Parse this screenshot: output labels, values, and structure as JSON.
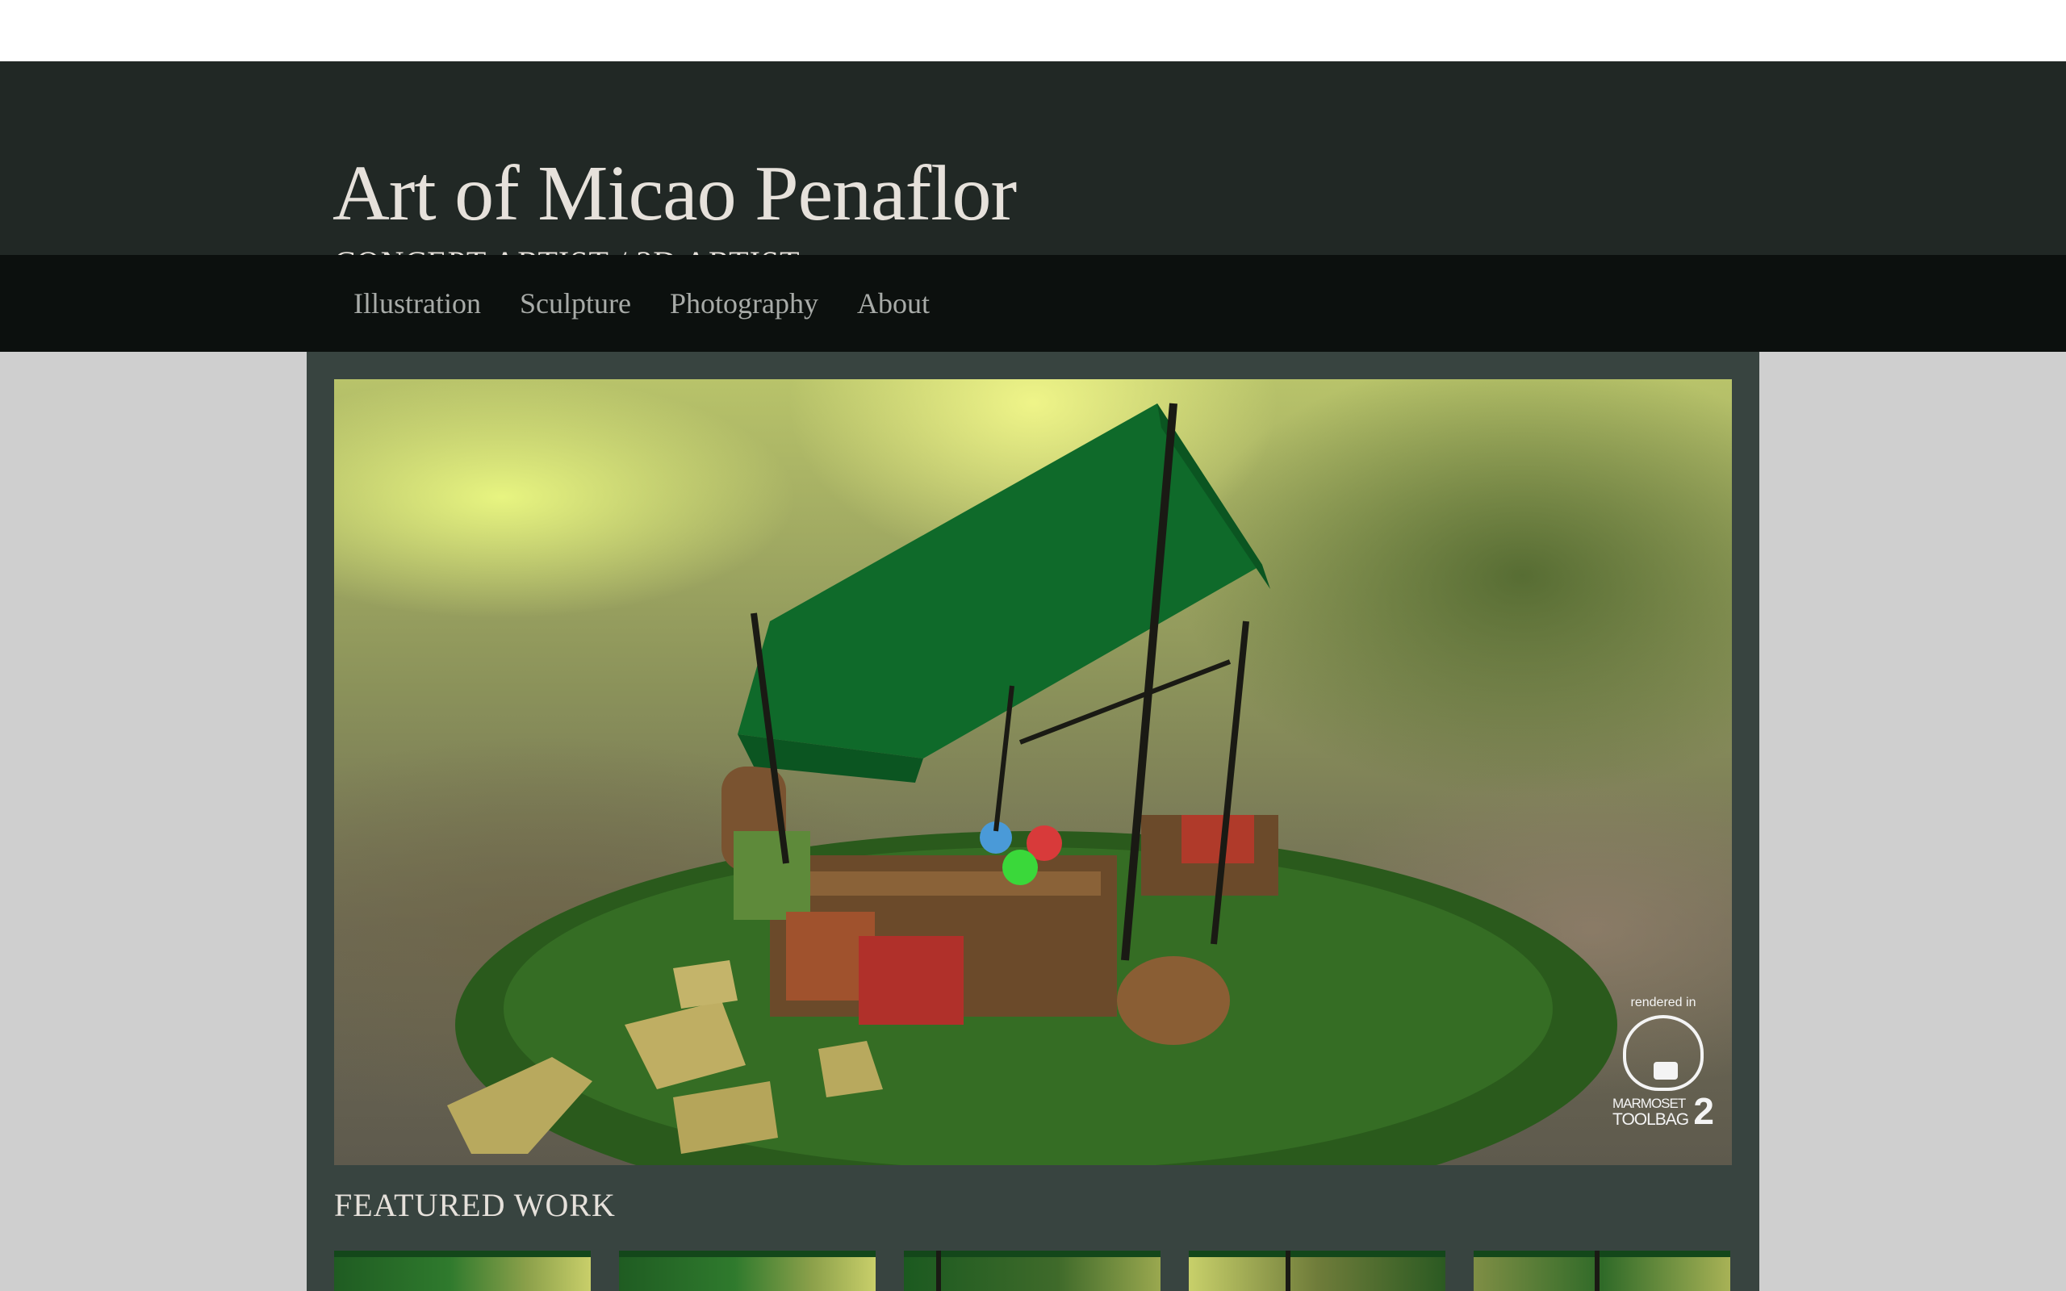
{
  "site": {
    "title": "Art of Micao Penaflor",
    "subtitle": "CONCEPT ARTIST / 3D ARTIST"
  },
  "nav": {
    "items": [
      {
        "label": "Illustration"
      },
      {
        "label": "Sculpture"
      },
      {
        "label": "Photography"
      },
      {
        "label": "About"
      }
    ]
  },
  "hero": {
    "watermark_prefix": "rendered in",
    "watermark_line1": "MARMOSET",
    "watermark_line2": "TOOLBAG",
    "watermark_version": "2"
  },
  "featured": {
    "title": "FEATURED WORK",
    "thumbnail_count": 5
  },
  "colors": {
    "header_bg": "#212825",
    "nav_bg": "#0c100e",
    "panel_bg": "#384440",
    "page_bg": "#cfcfcf",
    "title_text": "#e6e1db",
    "nav_text": "#a8aba8",
    "tent_green": "#0f6a2a"
  }
}
